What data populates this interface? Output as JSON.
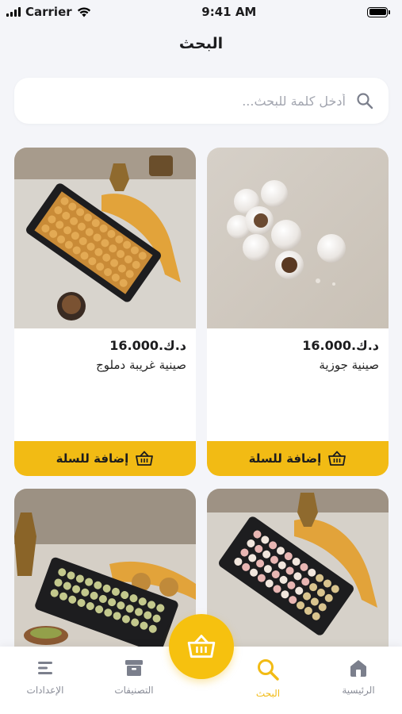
{
  "status_bar": {
    "carrier": "Carrier",
    "time": "9:41 AM"
  },
  "header": {
    "title": "البحث"
  },
  "search": {
    "placeholder": "أدخل كلمة للبحث...",
    "value": ""
  },
  "products": [
    {
      "name": "صينية جوزية",
      "price": "د.ك.16.000",
      "button_label": "إضافة للسلة"
    },
    {
      "name": "صينية غريبة دملوج",
      "price": "د.ك.16.000",
      "button_label": "إضافة للسلة"
    },
    {
      "name": "",
      "price": "",
      "button_label": ""
    },
    {
      "name": "",
      "price": "",
      "button_label": ""
    }
  ],
  "bottom_nav": {
    "items": [
      {
        "label": "الرئيسية",
        "icon": "home-icon"
      },
      {
        "label": "البحث",
        "icon": "search-icon",
        "active": true
      },
      {
        "label": "التصنيفات",
        "icon": "categories-icon"
      },
      {
        "label": "الإعدادات",
        "icon": "settings-icon"
      }
    ],
    "cart_icon": "basket-icon"
  },
  "colors": {
    "accent": "#f2bb14",
    "background": "#f4f5f9",
    "inactive": "#8a8d98"
  }
}
